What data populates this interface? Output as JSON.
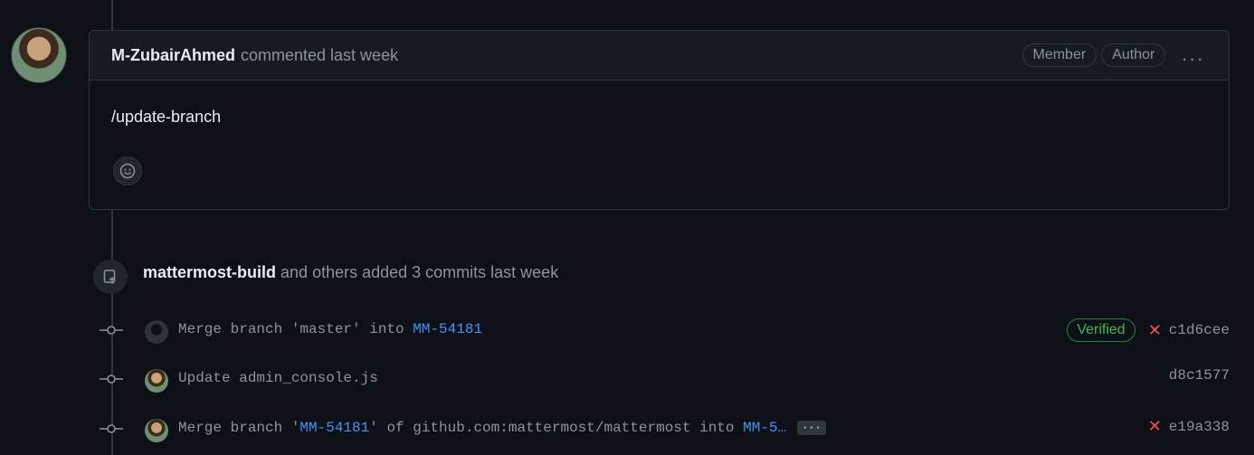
{
  "comment": {
    "author": "M-ZubairAhmed",
    "meta": "commented last week",
    "badges": [
      "Member",
      "Author"
    ],
    "more_icon": "...",
    "body": "/update-branch"
  },
  "push_event": {
    "actor": "mattermost-build",
    "text": "and others added 3 commits last week"
  },
  "commits": [
    {
      "message_prefix": "Merge branch 'master' into ",
      "message_link": "MM-54181",
      "verified": "Verified",
      "status": "failed",
      "sha": "c1d6cee"
    },
    {
      "message_prefix": "Update admin_console.js",
      "sha": "d8c1577"
    },
    {
      "message_prefix": "Merge branch '",
      "branch_link": "MM-54181",
      "message_middle": "' of github.com:mattermost/mattermost into ",
      "message_link": "MM-5…",
      "ellipsis": "···",
      "status": "failed",
      "sha": "e19a338"
    }
  ],
  "colors": {
    "background": "#0d1117",
    "link": "#4493f8",
    "verified": "#3fb950",
    "failed": "#f85149"
  }
}
